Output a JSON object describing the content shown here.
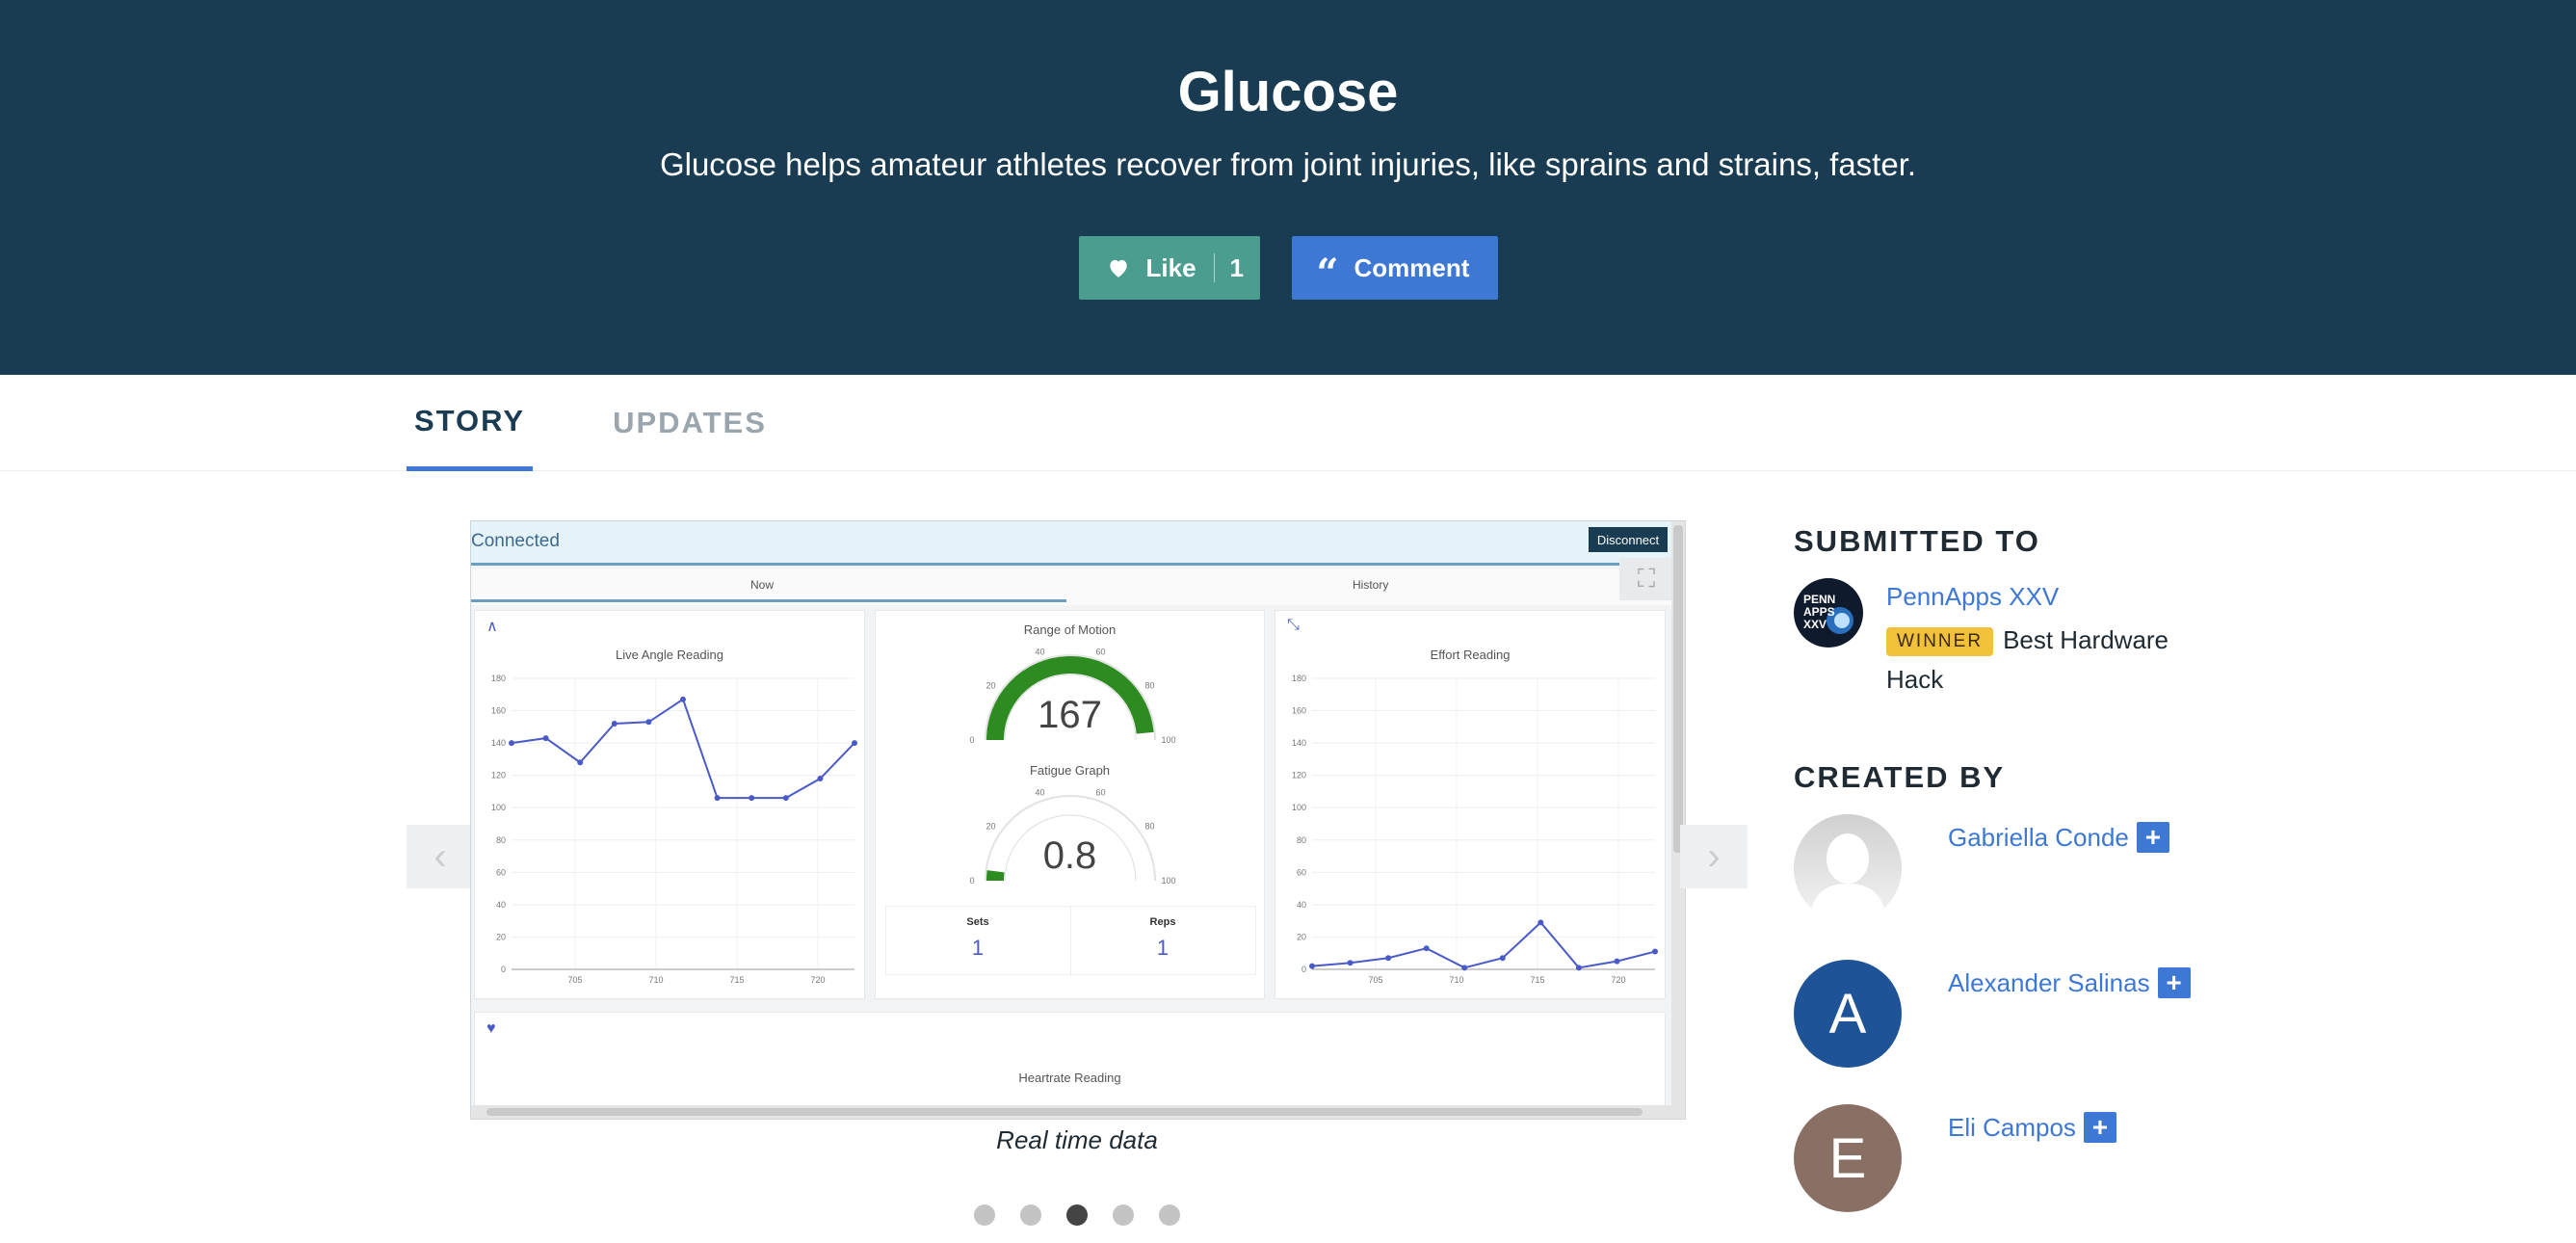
{
  "hero": {
    "title": "Glucose",
    "tagline": "Glucose helps amateur athletes recover from joint injuries, like sprains and strains, faster.",
    "like_label": "Like",
    "like_count": "1",
    "comment_label": "Comment"
  },
  "tabs": [
    {
      "label": "STORY",
      "active": true
    },
    {
      "label": "UPDATES",
      "active": false
    }
  ],
  "carousel": {
    "caption": "Real time data",
    "dot_count": 5,
    "active_dot": 3,
    "prev_glyph": "‹",
    "next_glyph": "›",
    "screenshot": {
      "status": "Connected",
      "disconnect_label": "Disconnect",
      "tab_now": "Now",
      "tab_history": "History",
      "live_angle_title": "Live Angle Reading",
      "range_title": "Range of Motion",
      "range_value": "167",
      "fatigue_title": "Fatigue Graph",
      "fatigue_value": "0.8",
      "effort_title": "Effort Reading",
      "sets_label": "Sets",
      "sets_value": "1",
      "reps_label": "Reps",
      "reps_value": "1",
      "heartrate_title": "Heartrate Reading",
      "y_ticks": [
        "0",
        "20",
        "40",
        "60",
        "80",
        "100",
        "120",
        "140",
        "160",
        "180"
      ],
      "x_ticks": [
        "705",
        "710",
        "715",
        "720"
      ],
      "gauge_ticks": [
        "0",
        "20",
        "40",
        "60",
        "80",
        "100"
      ],
      "live_angle_series": [
        140,
        143,
        128,
        152,
        153,
        167,
        106,
        106,
        106,
        118,
        140
      ],
      "effort_series": [
        2,
        4,
        7,
        13,
        1,
        7,
        29,
        1,
        5,
        11
      ]
    }
  },
  "sidebar": {
    "submitted_heading": "SUBMITTED TO",
    "hackathon_name": "PennApps XXV",
    "hackathon_logo_text": [
      "PENN",
      "APPS",
      "XXV"
    ],
    "winner_badge": "WINNER",
    "prize": "Best Hardware Hack",
    "created_heading": "CREATED BY",
    "members": [
      {
        "name": "Gabriella Conde",
        "initial": "",
        "avatar_color": "#d9d9d9"
      },
      {
        "name": "Alexander Salinas",
        "initial": "A",
        "avatar_color": "#1e5397"
      },
      {
        "name": "Eli Campos",
        "initial": "E",
        "avatar_color": "#8a6f65"
      }
    ]
  },
  "colors": {
    "header_bg": "#1a3c53",
    "like_bg": "#4b9d90",
    "comment_bg": "#3d78d4",
    "link": "#3d78d4",
    "winner": "#f1c13b",
    "gauge_green": "#2e8b22",
    "chart_line": "#4a5bc8"
  }
}
